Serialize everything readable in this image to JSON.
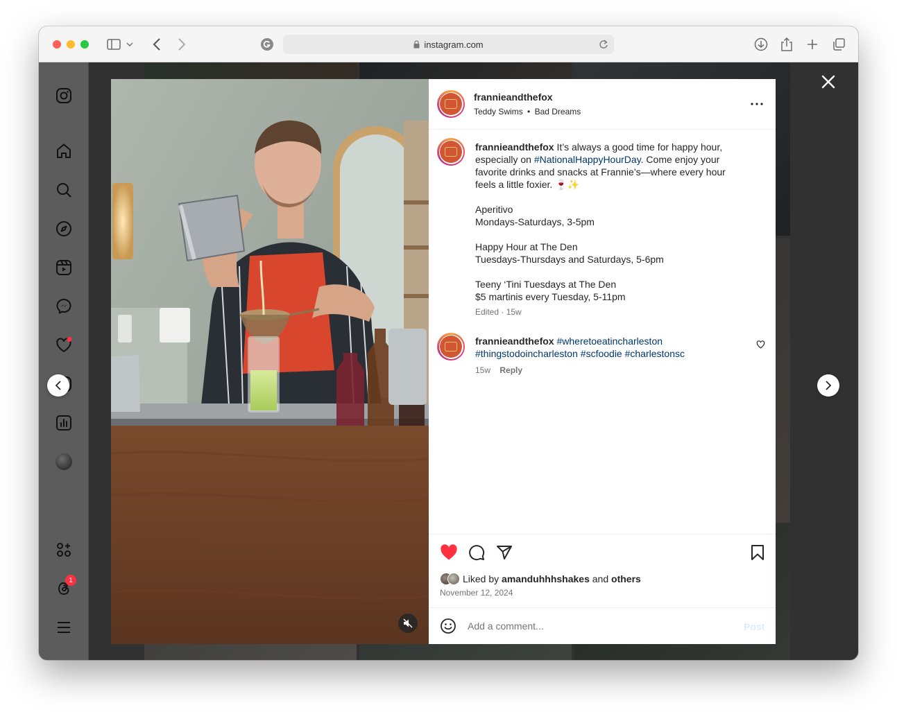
{
  "browser": {
    "url": "instagram.com",
    "colors": {
      "close": "#ff5f57",
      "minimize": "#febc2e",
      "zoom": "#28c840"
    }
  },
  "sidebar": {
    "icons": [
      "instagram-logo-icon",
      "home-icon",
      "search-icon",
      "explore-icon",
      "reels-icon",
      "messenger-icon",
      "heart-icon",
      "create-icon",
      "dashboard-icon",
      "profile-avatar",
      "also-from-meta-icon",
      "threads-icon",
      "menu-icon"
    ],
    "threads_badge": "1"
  },
  "post": {
    "username": "frannieandthefox",
    "audio_artist": "Teddy Swims",
    "audio_separator": "•",
    "audio_track": "Bad Dreams",
    "caption": {
      "p1_before": "It’s always a good time for happy hour, especially on ",
      "p1_tag": "#NationalHappyHourDay",
      "p1_after": ". Come enjoy your favorite drinks and snacks at Frannie’s—where every hour feels a little foxier. 🍷✨",
      "line_aperitivo": "Aperitivo",
      "line_aperitivo_time": "Mondays-Saturdays, 3-5pm",
      "line_happy_hour": "Happy Hour at The Den",
      "line_happy_hour_time": "Tuesdays-Thursdays and Saturdays, 5-6pm",
      "line_teeny": "Teeny ‘Tini Tuesdays at The Den",
      "line_teeny_price": "$5 martinis every Tuesday, 5-11pm",
      "edited": "Edited · 15w"
    },
    "comment": {
      "username": "frannieandthefox",
      "tags": [
        "#wheretoeatincharleston",
        "#thingstodoincharleston",
        "#scfoodie",
        "#charlestonsc"
      ],
      "age": "15w",
      "reply_label": "Reply"
    },
    "likes": {
      "prefix": "Liked by",
      "user": "amanduhhhshakes",
      "and": "and",
      "others": "others"
    },
    "date": "November 12, 2024",
    "comment_placeholder": "Add a comment...",
    "post_label": "Post",
    "liked": true,
    "colors": {
      "heart": "#ff3040",
      "link": "#00376b",
      "post_disabled": "#b2dffc"
    }
  }
}
